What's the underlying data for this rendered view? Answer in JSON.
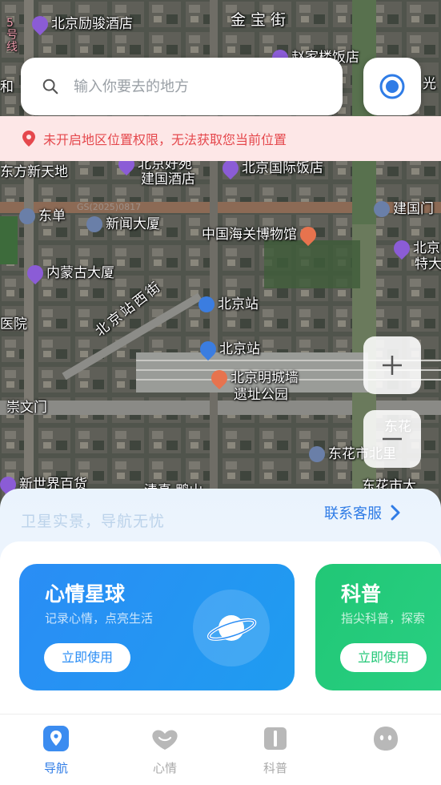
{
  "map": {
    "labels": {
      "hotel_lijun": "北京励骏酒店",
      "jinbao_street": "金宝街",
      "zhaojia_restaurant": "赵家楼饭店",
      "line5": "5号线",
      "he": "和",
      "guang": "光",
      "dongfang_xintiandi": "东方新天地",
      "beijing_haoyuan": "北京好苑",
      "jianguo_hotel": "建国酒店",
      "beijing_intl_hotel": "北京国际饭店",
      "jianguomen": "建国门",
      "dongdan": "东单",
      "watermark": "GS(2025)0817",
      "news_building": "新闻大厦",
      "customs_museum": "中国海关博物馆",
      "beijing_te": "北京",
      "te_da": "特大",
      "inner_mongolia": "内蒙古大厦",
      "beijing_station_west": "北京站西街",
      "beijing_station_metro": "北京站",
      "hospital": "医院",
      "beijing_station": "北京站",
      "ming_wall_1": "北京明城墙",
      "ming_wall_2": "遗址公园",
      "chongwenmen": "崇文门",
      "donghua": "东花",
      "donghuashi_beili": "东花市北里",
      "new_world": "新世界百货",
      "qinglong": "清真·鸭山",
      "donghuashi_da": "东花市大"
    }
  },
  "search": {
    "placeholder": "输入你要去的地方"
  },
  "warning": {
    "text": "未开启地区位置权限，无法获取您当前位置"
  },
  "panel": {
    "slogan": "卫星实景，导航无忧",
    "contact": "联系客服"
  },
  "cards": [
    {
      "title": "心情星球",
      "subtitle": "记录心情，点亮生活",
      "button": "立即使用"
    },
    {
      "title": "科普",
      "subtitle": "指尖科普，探索",
      "button": "立即使用"
    }
  ],
  "tabs": [
    {
      "label": "导航"
    },
    {
      "label": "心情"
    },
    {
      "label": "科普"
    },
    {
      "label": ""
    }
  ],
  "colors": {
    "accent": "#2f7ce6",
    "warning": "#e5484d",
    "card_blue": "#2a8df5",
    "card_green": "#21c776"
  }
}
